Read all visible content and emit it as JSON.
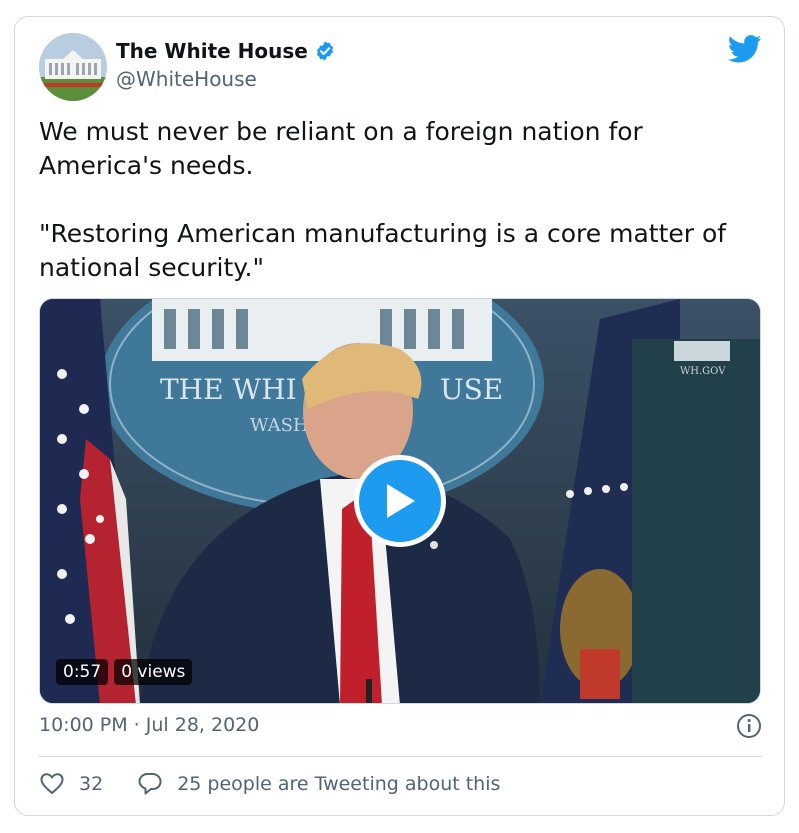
{
  "author": {
    "display_name": "The White House",
    "handle": "@WhiteHouse"
  },
  "tweet": {
    "line1": "We must never be reliant on a foreign nation for America's needs.",
    "line2": "\"Restoring American manufacturing is a core matter of national security.\""
  },
  "video": {
    "duration": "0:57",
    "views": "0 views",
    "seal_text_top": "THE WHI",
    "seal_text_top2": "USE",
    "seal_text_bottom": "WASH",
    "wh_gov": "WH.GOV"
  },
  "footer": {
    "timestamp": "10:00 PM · Jul 28, 2020",
    "likes": "32",
    "tweeting": "25 people are Tweeting about this"
  },
  "colors": {
    "accent": "#1d9bf0",
    "text": "#0f1419",
    "muted": "#536471"
  },
  "icons": [
    "avatar",
    "verified-badge-icon",
    "twitter-bird-icon",
    "play-icon",
    "info-icon",
    "heart-icon",
    "reply-bubble-icon"
  ]
}
